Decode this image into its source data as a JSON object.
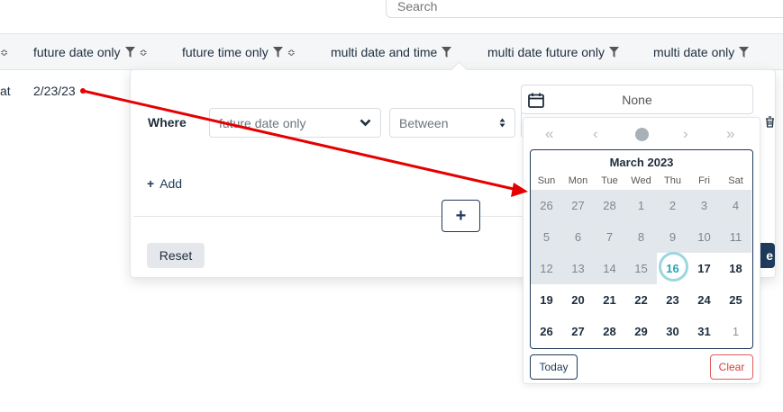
{
  "search": {
    "placeholder": "Search"
  },
  "columns": [
    {
      "label": "future date only"
    },
    {
      "label": "future time only"
    },
    {
      "label": "multi date and time"
    },
    {
      "label": "multi date future only"
    },
    {
      "label": "multi date only"
    }
  ],
  "row": {
    "partial_text": "at",
    "date_value": "2/23/23"
  },
  "filter": {
    "where_label": "Where",
    "field_value": "future date only",
    "operator_value": "Between",
    "add_label": "Add",
    "plus_label": "+",
    "reset_label": "Reset",
    "apply_partial": "e"
  },
  "date_input": {
    "value": "None"
  },
  "calendar": {
    "nav": {
      "prev_year": "«",
      "prev_month": "‹",
      "next_month": "›",
      "next_year": "»"
    },
    "month_title": "March 2023",
    "weekdays": [
      "Sun",
      "Mon",
      "Tue",
      "Wed",
      "Thu",
      "Fri",
      "Sat"
    ],
    "weeks": [
      [
        "26",
        "27",
        "28",
        "1",
        "2",
        "3",
        "4"
      ],
      [
        "5",
        "6",
        "7",
        "8",
        "9",
        "10",
        "11"
      ],
      [
        "12",
        "13",
        "14",
        "15",
        "16",
        "17",
        "18"
      ],
      [
        "19",
        "20",
        "21",
        "22",
        "23",
        "24",
        "25"
      ],
      [
        "26",
        "27",
        "28",
        "29",
        "30",
        "31",
        "1"
      ]
    ],
    "today_label": "Today",
    "clear_label": "Clear",
    "selected_today": "16"
  },
  "colors": {
    "accent": "#1f3a5a",
    "today": "#24a6b8",
    "arrow": "#e60000",
    "clear": "#d93c3c"
  }
}
